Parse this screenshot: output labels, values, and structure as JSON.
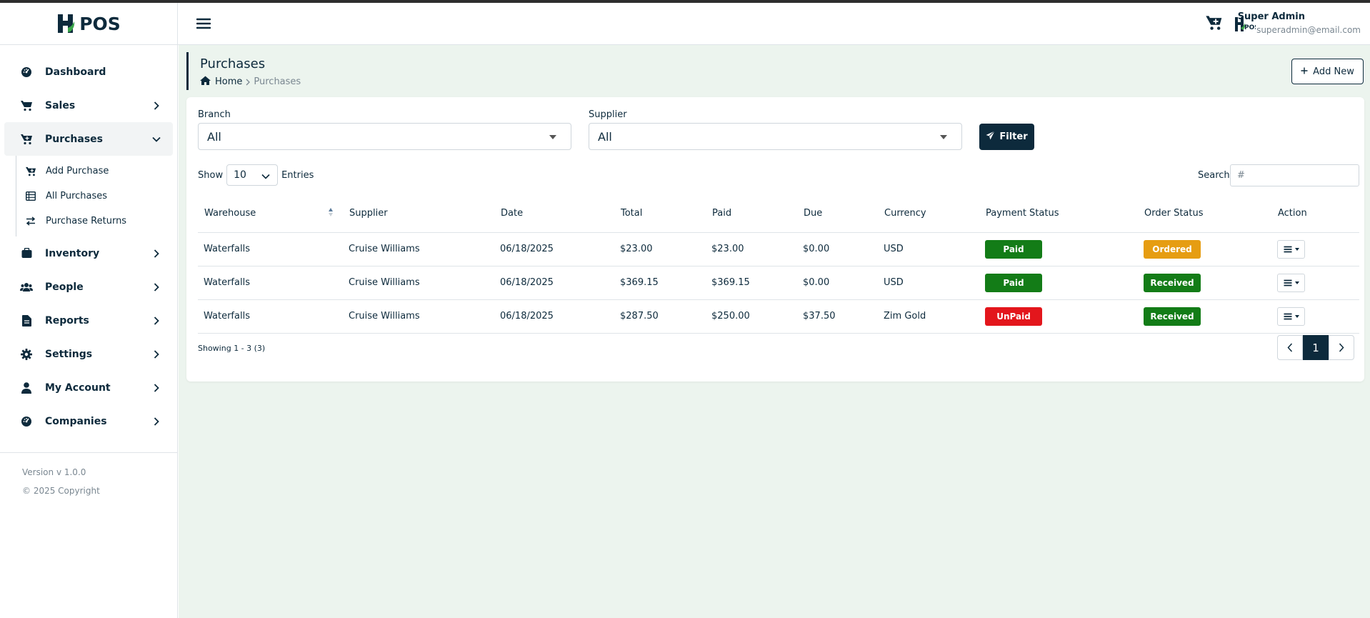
{
  "brand": {
    "name": "POS"
  },
  "sidebar": {
    "items": [
      {
        "label": "Dashboard",
        "icon": "dashboard-icon"
      },
      {
        "label": "Sales",
        "icon": "cart-icon"
      },
      {
        "label": "Purchases",
        "icon": "cart-icon"
      },
      {
        "label": "Inventory",
        "icon": "inventory-icon"
      },
      {
        "label": "People",
        "icon": "people-icon"
      },
      {
        "label": "Reports",
        "icon": "report-icon"
      },
      {
        "label": "Settings",
        "icon": "gear-icon"
      },
      {
        "label": "My Account",
        "icon": "user-icon"
      },
      {
        "label": "Companies",
        "icon": "companies-icon"
      }
    ],
    "purchases_sub": [
      {
        "label": "Add Purchase",
        "icon": "cart-plus-icon"
      },
      {
        "label": "All Purchases",
        "icon": "list-icon"
      },
      {
        "label": "Purchase Returns",
        "icon": "exchange-icon"
      }
    ],
    "version": "Version v 1.0.0",
    "copyright": "© 2025 Copyright"
  },
  "header": {
    "user_name": "Super Admin",
    "user_email": "superadmin@email.com",
    "avatar_text": "POS"
  },
  "page": {
    "title": "Purchases",
    "breadcrumb_home": "Home",
    "breadcrumb_current": "Purchases",
    "add_new_label": "Add New"
  },
  "filters": {
    "branch_label": "Branch",
    "branch_value": "All",
    "supplier_label": "Supplier",
    "supplier_value": "All",
    "filter_button": "Filter"
  },
  "table_controls": {
    "show_label": "Show",
    "entries_value": "10",
    "entries_label": "Entries",
    "search_label": "Search",
    "search_placeholder": "#"
  },
  "table": {
    "columns": [
      "Warehouse",
      "Supplier",
      "Date",
      "Total",
      "Paid",
      "Due",
      "Currency",
      "Payment Status",
      "Order Status",
      "Action"
    ],
    "rows": [
      {
        "warehouse": "Waterfalls",
        "supplier": "Cruise Williams",
        "date": "06/18/2025",
        "total": "$23.00",
        "paid": "$23.00",
        "due": "$0.00",
        "currency": "USD",
        "payment_status": "Paid",
        "order_status": "Ordered"
      },
      {
        "warehouse": "Waterfalls",
        "supplier": "Cruise Williams",
        "date": "06/18/2025",
        "total": "$369.15",
        "paid": "$369.15",
        "due": "$0.00",
        "currency": "USD",
        "payment_status": "Paid",
        "order_status": "Received"
      },
      {
        "warehouse": "Waterfalls",
        "supplier": "Cruise Williams",
        "date": "06/18/2025",
        "total": "$287.50",
        "paid": "$250.00",
        "due": "$37.50",
        "currency": "Zim Gold",
        "payment_status": "UnPaid",
        "order_status": "Received"
      }
    ],
    "showing": "Showing 1 - 3 (3)",
    "current_page": "1"
  },
  "colors": {
    "primary": "#0d2a3c",
    "paid": "#137c17",
    "unpaid": "#e3161c",
    "ordered": "#e69d12",
    "received": "#137c17",
    "main_bg": "#ecf4ee"
  }
}
